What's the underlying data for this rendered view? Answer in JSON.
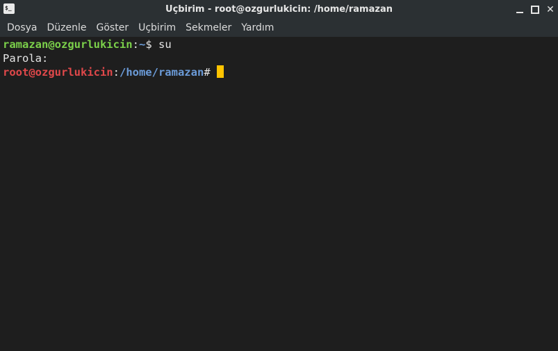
{
  "window": {
    "title": "Uçbirim - root@ozgurlukicin: /home/ramazan",
    "app_icon_text": "$_",
    "controls": [
      "minimize",
      "maximize",
      "close"
    ],
    "close_glyph": "✕"
  },
  "menu": {
    "items": [
      "Dosya",
      "Düzenle",
      "Göster",
      "Uçbirim",
      "Sekmeler",
      "Yardım"
    ]
  },
  "terminal": {
    "line1": {
      "user_host": "ramazan@ozgurlukicin",
      "separator": ":",
      "path": "~",
      "prompt_char": "$ ",
      "command": "su"
    },
    "line2": {
      "text": "Parola:"
    },
    "line3": {
      "user_host": "root@ozgurlukicin",
      "separator": ":",
      "path": "/home/ramazan",
      "prompt_char": "# "
    }
  },
  "colors": {
    "background": "#1e1e1e",
    "titlebar": "#2b3033",
    "user_prompt": "#7bd04a",
    "root_prompt": "#e0484a",
    "path": "#6b9bd8",
    "cursor": "#ffc400"
  }
}
